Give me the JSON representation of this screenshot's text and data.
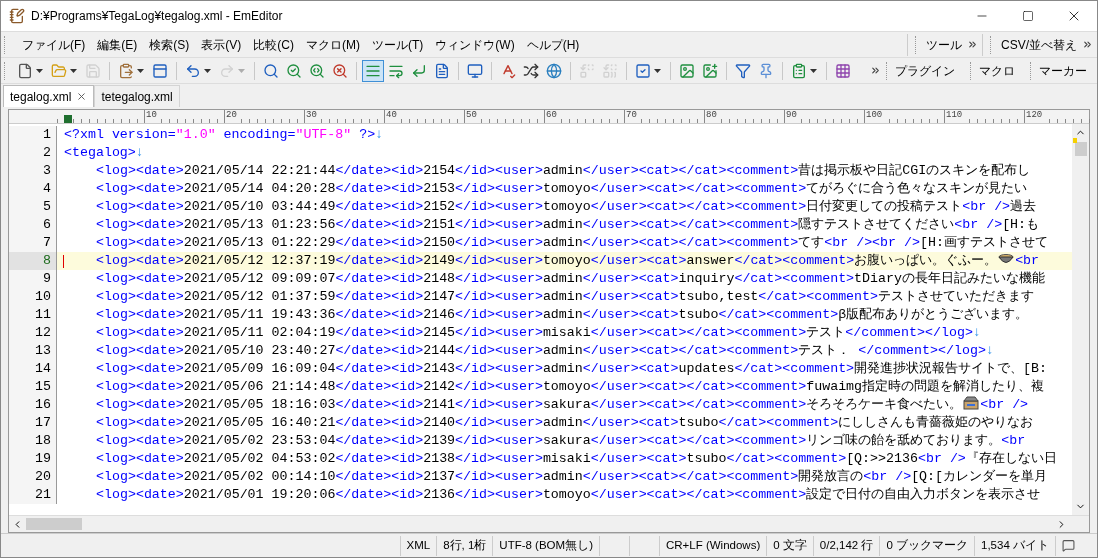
{
  "window": {
    "title": "D:¥Programs¥TegaLog¥tegalog.xml - EmEditor"
  },
  "menu": [
    "ファイル(F)",
    "編集(E)",
    "検索(S)",
    "表示(V)",
    "比較(C)",
    "マクロ(M)",
    "ツール(T)",
    "ウィンドウ(W)",
    "ヘルプ(H)"
  ],
  "menu_toolbars": [
    "ツール",
    "CSV/並べ替え"
  ],
  "toolbar": [
    {
      "kind": "button",
      "disabled": false,
      "pressed": false,
      "dropdown": true
    },
    {
      "kind": "button",
      "disabled": false,
      "pressed": false,
      "dropdown": true
    },
    {
      "kind": "button",
      "disabled": true,
      "pressed": false,
      "dropdown": false
    },
    {
      "kind": "separator"
    },
    {
      "kind": "button",
      "disabled": false,
      "pressed": false,
      "dropdown": true
    },
    {
      "kind": "button",
      "disabled": false,
      "pressed": false,
      "dropdown": false
    },
    {
      "kind": "separator"
    },
    {
      "kind": "button",
      "disabled": false,
      "pressed": false,
      "dropdown": true
    },
    {
      "kind": "button",
      "disabled": true,
      "pressed": false,
      "dropdown": true
    },
    {
      "kind": "separator"
    },
    {
      "kind": "button",
      "disabled": false,
      "pressed": false,
      "dropdown": false
    },
    {
      "kind": "button",
      "disabled": false,
      "pressed": false,
      "dropdown": false
    },
    {
      "kind": "button",
      "disabled": false,
      "pressed": false,
      "dropdown": false
    },
    {
      "kind": "button",
      "disabled": false,
      "pressed": false,
      "dropdown": false
    },
    {
      "kind": "separator"
    },
    {
      "kind": "button",
      "disabled": false,
      "pressed": true,
      "dropdown": false
    },
    {
      "kind": "button",
      "disabled": false,
      "pressed": false,
      "dropdown": false
    },
    {
      "kind": "button",
      "disabled": false,
      "pressed": false,
      "dropdown": false
    },
    {
      "kind": "button",
      "disabled": false,
      "pressed": false,
      "dropdown": false
    },
    {
      "kind": "separator"
    },
    {
      "kind": "button",
      "disabled": false,
      "pressed": false,
      "dropdown": false
    },
    {
      "kind": "separator"
    },
    {
      "kind": "button",
      "disabled": false,
      "pressed": false,
      "dropdown": false
    },
    {
      "kind": "button",
      "disabled": false,
      "pressed": false,
      "dropdown": false
    },
    {
      "kind": "button",
      "disabled": false,
      "pressed": false,
      "dropdown": false
    },
    {
      "kind": "separator"
    },
    {
      "kind": "button",
      "disabled": true,
      "pressed": false,
      "dropdown": false
    },
    {
      "kind": "button",
      "disabled": true,
      "pressed": false,
      "dropdown": false
    },
    {
      "kind": "separator"
    },
    {
      "kind": "button",
      "disabled": false,
      "pressed": false,
      "dropdown": true
    },
    {
      "kind": "separator"
    },
    {
      "kind": "button",
      "disabled": false,
      "pressed": false,
      "dropdown": false
    },
    {
      "kind": "button",
      "disabled": false,
      "pressed": false,
      "dropdown": false
    },
    {
      "kind": "separator"
    },
    {
      "kind": "button",
      "disabled": false,
      "pressed": false,
      "dropdown": false
    },
    {
      "kind": "button",
      "disabled": false,
      "pressed": false,
      "dropdown": false
    },
    {
      "kind": "separator"
    },
    {
      "kind": "button",
      "disabled": false,
      "pressed": false,
      "dropdown": true
    },
    {
      "kind": "separator"
    },
    {
      "kind": "button",
      "disabled": false,
      "pressed": false,
      "dropdown": false
    }
  ],
  "toolbar_groups": [
    "プラグイン",
    "マクロ",
    "マーカー"
  ],
  "tabs": [
    {
      "label": "tegalog.xml",
      "selected": true
    },
    {
      "label": "tetegalog.xml",
      "selected": false
    }
  ],
  "ruler": {
    "labels": [
      "10",
      "20",
      "30",
      "40",
      "50",
      "60",
      "70",
      "80",
      "90",
      "100",
      "110",
      "120"
    ]
  },
  "lines": [
    {
      "number": "1",
      "indented": false,
      "current": false,
      "segments": [
        {
          "kind": "tag",
          "text": "<?xml version="
        },
        {
          "kind": "string",
          "text": "\"1.0\""
        },
        {
          "kind": "tag",
          "text": " encoding="
        },
        {
          "kind": "string",
          "text": "\"UTF-8\""
        },
        {
          "kind": "tag",
          "text": " ?>"
        },
        {
          "kind": "eol",
          "text": "↓"
        }
      ]
    },
    {
      "number": "2",
      "indented": false,
      "current": false,
      "segments": [
        {
          "kind": "tag",
          "text": "<tegalog>"
        },
        {
          "kind": "eol",
          "text": "↓"
        }
      ]
    },
    {
      "number": "3",
      "indented": true,
      "current": false,
      "segments": [
        {
          "kind": "tag",
          "text": "<log><date>"
        },
        {
          "kind": "text",
          "text": "2021/05/14 22:21:44"
        },
        {
          "kind": "tag",
          "text": "</date><id>"
        },
        {
          "kind": "text",
          "text": "2154"
        },
        {
          "kind": "tag",
          "text": "</id><user>"
        },
        {
          "kind": "text",
          "text": "admin"
        },
        {
          "kind": "tag",
          "text": "</user><cat></cat><comment>"
        },
        {
          "kind": "text",
          "text": "昔は掲示板や日記CGIのスキンを配布し"
        }
      ]
    },
    {
      "number": "4",
      "indented": true,
      "current": false,
      "segments": [
        {
          "kind": "tag",
          "text": "<log><date>"
        },
        {
          "kind": "text",
          "text": "2021/05/14 04:20:28"
        },
        {
          "kind": "tag",
          "text": "</date><id>"
        },
        {
          "kind": "text",
          "text": "2153"
        },
        {
          "kind": "tag",
          "text": "</id><user>"
        },
        {
          "kind": "text",
          "text": "tomoyo"
        },
        {
          "kind": "tag",
          "text": "</user><cat></cat><comment>"
        },
        {
          "kind": "text",
          "text": "てがろぐに合う色々なスキンが見たい"
        }
      ]
    },
    {
      "number": "5",
      "indented": true,
      "current": false,
      "segments": [
        {
          "kind": "tag",
          "text": "<log><date>"
        },
        {
          "kind": "text",
          "text": "2021/05/10 03:44:49"
        },
        {
          "kind": "tag",
          "text": "</date><id>"
        },
        {
          "kind": "text",
          "text": "2152"
        },
        {
          "kind": "tag",
          "text": "</id><user>"
        },
        {
          "kind": "text",
          "text": "tomoyo"
        },
        {
          "kind": "tag",
          "text": "</user><cat></cat><comment>"
        },
        {
          "kind": "text",
          "text": "日付変更しての投稿テスト"
        },
        {
          "kind": "tag",
          "text": "<br />"
        },
        {
          "kind": "text",
          "text": "過去"
        }
      ]
    },
    {
      "number": "6",
      "indented": true,
      "current": false,
      "segments": [
        {
          "kind": "tag",
          "text": "<log><date>"
        },
        {
          "kind": "text",
          "text": "2021/05/13 01:23:56"
        },
        {
          "kind": "tag",
          "text": "</date><id>"
        },
        {
          "kind": "text",
          "text": "2151"
        },
        {
          "kind": "tag",
          "text": "</id><user>"
        },
        {
          "kind": "text",
          "text": "admin"
        },
        {
          "kind": "tag",
          "text": "</user><cat></cat><comment>"
        },
        {
          "kind": "text",
          "text": "隠すテストさせてください"
        },
        {
          "kind": "tag",
          "text": "<br />"
        },
        {
          "kind": "text",
          "text": "[H:も"
        }
      ]
    },
    {
      "number": "7",
      "indented": true,
      "current": false,
      "segments": [
        {
          "kind": "tag",
          "text": "<log><date>"
        },
        {
          "kind": "text",
          "text": "2021/05/13 01:22:29"
        },
        {
          "kind": "tag",
          "text": "</date><id>"
        },
        {
          "kind": "text",
          "text": "2150"
        },
        {
          "kind": "tag",
          "text": "</id><user>"
        },
        {
          "kind": "text",
          "text": "admin"
        },
        {
          "kind": "tag",
          "text": "</user><cat></cat><comment>"
        },
        {
          "kind": "text",
          "text": "てす"
        },
        {
          "kind": "tag",
          "text": "<br /><br />"
        },
        {
          "kind": "text",
          "text": "[H:画すテストさせて"
        }
      ]
    },
    {
      "number": "8",
      "indented": true,
      "current": true,
      "segments": [
        {
          "kind": "tag",
          "text": "<log><date>"
        },
        {
          "kind": "text",
          "text": "2021/05/12 12:37:19"
        },
        {
          "kind": "tag",
          "text": "</date><id>"
        },
        {
          "kind": "text",
          "text": "2149"
        },
        {
          "kind": "tag",
          "text": "</id><user>"
        },
        {
          "kind": "text",
          "text": "tomoyo"
        },
        {
          "kind": "tag",
          "text": "</user><cat>"
        },
        {
          "kind": "text",
          "text": "answer"
        },
        {
          "kind": "tag",
          "text": "</cat><comment>"
        },
        {
          "kind": "text",
          "text": "お腹いっぱい。ぐふー。"
        },
        {
          "kind": "bowl"
        },
        {
          "kind": "tag",
          "text": "<br"
        }
      ]
    },
    {
      "number": "9",
      "indented": true,
      "current": false,
      "segments": [
        {
          "kind": "tag",
          "text": "<log><date>"
        },
        {
          "kind": "text",
          "text": "2021/05/12 09:09:07"
        },
        {
          "kind": "tag",
          "text": "</date><id>"
        },
        {
          "kind": "text",
          "text": "2148"
        },
        {
          "kind": "tag",
          "text": "</id><user>"
        },
        {
          "kind": "text",
          "text": "admin"
        },
        {
          "kind": "tag",
          "text": "</user><cat>"
        },
        {
          "kind": "text",
          "text": "inquiry"
        },
        {
          "kind": "tag",
          "text": "</cat><comment>"
        },
        {
          "kind": "text",
          "text": "tDiaryの長年日記みたいな機能"
        }
      ]
    },
    {
      "number": "10",
      "indented": true,
      "current": false,
      "segments": [
        {
          "kind": "tag",
          "text": "<log><date>"
        },
        {
          "kind": "text",
          "text": "2021/05/12 01:37:59"
        },
        {
          "kind": "tag",
          "text": "</date><id>"
        },
        {
          "kind": "text",
          "text": "2147"
        },
        {
          "kind": "tag",
          "text": "</id><user>"
        },
        {
          "kind": "text",
          "text": "admin"
        },
        {
          "kind": "tag",
          "text": "</user><cat>"
        },
        {
          "kind": "text",
          "text": "tsubo,test"
        },
        {
          "kind": "tag",
          "text": "</cat><comment>"
        },
        {
          "kind": "text",
          "text": "テストさせていただきます"
        }
      ]
    },
    {
      "number": "11",
      "indented": true,
      "current": false,
      "segments": [
        {
          "kind": "tag",
          "text": "<log><date>"
        },
        {
          "kind": "text",
          "text": "2021/05/11 19:43:36"
        },
        {
          "kind": "tag",
          "text": "</date><id>"
        },
        {
          "kind": "text",
          "text": "2146"
        },
        {
          "kind": "tag",
          "text": "</id><user>"
        },
        {
          "kind": "text",
          "text": "admin"
        },
        {
          "kind": "tag",
          "text": "</user><cat>"
        },
        {
          "kind": "text",
          "text": "tsubo"
        },
        {
          "kind": "tag",
          "text": "</cat><comment>"
        },
        {
          "kind": "text",
          "text": "β版配布ありがとうございます。"
        }
      ]
    },
    {
      "number": "12",
      "indented": true,
      "current": false,
      "segments": [
        {
          "kind": "tag",
          "text": "<log><date>"
        },
        {
          "kind": "text",
          "text": "2021/05/11 02:04:19"
        },
        {
          "kind": "tag",
          "text": "</date><id>"
        },
        {
          "kind": "text",
          "text": "2145"
        },
        {
          "kind": "tag",
          "text": "</id><user>"
        },
        {
          "kind": "text",
          "text": "misaki"
        },
        {
          "kind": "tag",
          "text": "</user><cat></cat><comment>"
        },
        {
          "kind": "text",
          "text": "テスト"
        },
        {
          "kind": "tag",
          "text": "</comment></log>"
        },
        {
          "kind": "eol",
          "text": "↓"
        }
      ]
    },
    {
      "number": "13",
      "indented": true,
      "current": false,
      "segments": [
        {
          "kind": "tag",
          "text": "<log><date>"
        },
        {
          "kind": "text",
          "text": "2021/05/10 23:40:27"
        },
        {
          "kind": "tag",
          "text": "</date><id>"
        },
        {
          "kind": "text",
          "text": "2144"
        },
        {
          "kind": "tag",
          "text": "</id><user>"
        },
        {
          "kind": "text",
          "text": "admin"
        },
        {
          "kind": "tag",
          "text": "</user><cat></cat><comment>"
        },
        {
          "kind": "text",
          "text": "テスト．"
        },
        {
          "kind": "tag",
          "text": " </comment></log>"
        },
        {
          "kind": "eol",
          "text": "↓"
        }
      ]
    },
    {
      "number": "14",
      "indented": true,
      "current": false,
      "segments": [
        {
          "kind": "tag",
          "text": "<log><date>"
        },
        {
          "kind": "text",
          "text": "2021/05/09 16:09:04"
        },
        {
          "kind": "tag",
          "text": "</date><id>"
        },
        {
          "kind": "text",
          "text": "2143"
        },
        {
          "kind": "tag",
          "text": "</id><user>"
        },
        {
          "kind": "text",
          "text": "admin"
        },
        {
          "kind": "tag",
          "text": "</user><cat>"
        },
        {
          "kind": "text",
          "text": "updates"
        },
        {
          "kind": "tag",
          "text": "</cat><comment>"
        },
        {
          "kind": "text",
          "text": "開発進捗状況報告サイトで、[B:"
        }
      ]
    },
    {
      "number": "15",
      "indented": true,
      "current": false,
      "segments": [
        {
          "kind": "tag",
          "text": "<log><date>"
        },
        {
          "kind": "text",
          "text": "2021/05/06 21:14:48"
        },
        {
          "kind": "tag",
          "text": "</date><id>"
        },
        {
          "kind": "text",
          "text": "2142"
        },
        {
          "kind": "tag",
          "text": "</id><user>"
        },
        {
          "kind": "text",
          "text": "tomoyo"
        },
        {
          "kind": "tag",
          "text": "</user><cat></cat><comment>"
        },
        {
          "kind": "text",
          "text": "fuwaimg指定時の問題を解消したり、複"
        }
      ]
    },
    {
      "number": "16",
      "indented": true,
      "current": false,
      "segments": [
        {
          "kind": "tag",
          "text": "<log><date>"
        },
        {
          "kind": "text",
          "text": "2021/05/05 18:16:03"
        },
        {
          "kind": "tag",
          "text": "</date><id>"
        },
        {
          "kind": "text",
          "text": "2141"
        },
        {
          "kind": "tag",
          "text": "</id><user>"
        },
        {
          "kind": "text",
          "text": "sakura"
        },
        {
          "kind": "tag",
          "text": "</user><cat></cat><comment>"
        },
        {
          "kind": "text",
          "text": "そろそろケーキ食べたい。"
        },
        {
          "kind": "cake"
        },
        {
          "kind": "tag",
          "text": "<br />"
        }
      ]
    },
    {
      "number": "17",
      "indented": true,
      "current": false,
      "segments": [
        {
          "kind": "tag",
          "text": "<log><date>"
        },
        {
          "kind": "text",
          "text": "2021/05/05 16:40:21"
        },
        {
          "kind": "tag",
          "text": "</date><id>"
        },
        {
          "kind": "text",
          "text": "2140"
        },
        {
          "kind": "tag",
          "text": "</id><user>"
        },
        {
          "kind": "text",
          "text": "admin"
        },
        {
          "kind": "tag",
          "text": "</user><cat>"
        },
        {
          "kind": "text",
          "text": "tsubo"
        },
        {
          "kind": "tag",
          "text": "</cat><comment>"
        },
        {
          "kind": "text",
          "text": "にししさんも青薔薇姫のやりなお"
        }
      ]
    },
    {
      "number": "18",
      "indented": true,
      "current": false,
      "segments": [
        {
          "kind": "tag",
          "text": "<log><date>"
        },
        {
          "kind": "text",
          "text": "2021/05/02 23:53:04"
        },
        {
          "kind": "tag",
          "text": "</date><id>"
        },
        {
          "kind": "text",
          "text": "2139"
        },
        {
          "kind": "tag",
          "text": "</id><user>"
        },
        {
          "kind": "text",
          "text": "sakura"
        },
        {
          "kind": "tag",
          "text": "</user><cat></cat><comment>"
        },
        {
          "kind": "text",
          "text": "リンゴ味の飴を舐めております。"
        },
        {
          "kind": "tag",
          "text": "<br"
        }
      ]
    },
    {
      "number": "19",
      "indented": true,
      "current": false,
      "segments": [
        {
          "kind": "tag",
          "text": "<log><date>"
        },
        {
          "kind": "text",
          "text": "2021/05/02 04:53:02"
        },
        {
          "kind": "tag",
          "text": "</date><id>"
        },
        {
          "kind": "text",
          "text": "2138"
        },
        {
          "kind": "tag",
          "text": "</id><user>"
        },
        {
          "kind": "text",
          "text": "misaki"
        },
        {
          "kind": "tag",
          "text": "</user><cat>"
        },
        {
          "kind": "text",
          "text": "tsubo"
        },
        {
          "kind": "tag",
          "text": "</cat><comment>"
        },
        {
          "kind": "text",
          "text": "[Q:>>2136"
        },
        {
          "kind": "tag",
          "text": "<br />"
        },
        {
          "kind": "text",
          "text": "『存在しない日"
        }
      ]
    },
    {
      "number": "20",
      "indented": true,
      "current": false,
      "segments": [
        {
          "kind": "tag",
          "text": "<log><date>"
        },
        {
          "kind": "text",
          "text": "2021/05/02 00:14:10"
        },
        {
          "kind": "tag",
          "text": "</date><id>"
        },
        {
          "kind": "text",
          "text": "2137"
        },
        {
          "kind": "tag",
          "text": "</id><user>"
        },
        {
          "kind": "text",
          "text": "admin"
        },
        {
          "kind": "tag",
          "text": "</user><cat></cat><comment>"
        },
        {
          "kind": "text",
          "text": "開発放言の"
        },
        {
          "kind": "tag",
          "text": "<br />"
        },
        {
          "kind": "text",
          "text": "[Q:[カレンダーを単月"
        }
      ]
    },
    {
      "number": "21",
      "indented": true,
      "current": false,
      "segments": [
        {
          "kind": "tag",
          "text": "<log><date>"
        },
        {
          "kind": "text",
          "text": "2021/05/01 19:20:06"
        },
        {
          "kind": "tag",
          "text": "</date><id>"
        },
        {
          "kind": "text",
          "text": "2136"
        },
        {
          "kind": "tag",
          "text": "</id><user>"
        },
        {
          "kind": "text",
          "text": "tomoyo"
        },
        {
          "kind": "tag",
          "text": "</user><cat></cat><comment>"
        },
        {
          "kind": "text",
          "text": "設定で日付の自由入力ボタンを表示させ"
        }
      ]
    }
  ],
  "status_bar": [
    {
      "kind": "field",
      "text": "XML"
    },
    {
      "kind": "field",
      "text": "8行, 1桁"
    },
    {
      "kind": "field",
      "text": "UTF-8 (BOM無し)"
    },
    {
      "kind": "blank"
    },
    {
      "kind": "blank"
    },
    {
      "kind": "field",
      "text": "CR+LF (Windows)"
    },
    {
      "kind": "field",
      "text": "0 文字"
    },
    {
      "kind": "field",
      "text": "0/2,142 行"
    },
    {
      "kind": "field",
      "text": "0 ブックマーク"
    },
    {
      "kind": "field",
      "text": "1,534 バイト"
    }
  ]
}
